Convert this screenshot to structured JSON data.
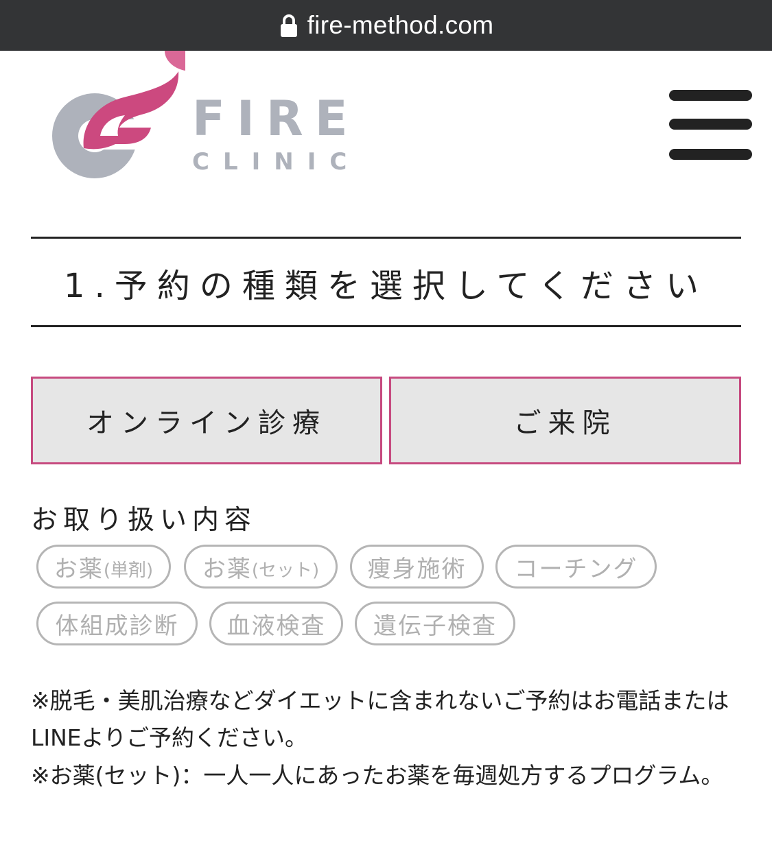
{
  "browser": {
    "url": "fire-method.com"
  },
  "logo": {
    "brand_main": "FIRE",
    "brand_sub": "CLINIC",
    "colors": {
      "pink": "#cc497f",
      "gray": "#aeb2bb"
    }
  },
  "header": {
    "menu_icon": "hamburger-menu-icon"
  },
  "section": {
    "title": "1.予約の種類を選択してください"
  },
  "reservation_types": [
    {
      "label": "オンライン診療"
    },
    {
      "label": "ご来院"
    }
  ],
  "handling": {
    "title": "お取り扱い内容",
    "tags": [
      {
        "main": "お薬",
        "sub": "(単剤)"
      },
      {
        "main": "お薬",
        "sub": "(セット)"
      },
      {
        "main": "痩身施術",
        "sub": ""
      },
      {
        "main": "コーチング",
        "sub": ""
      },
      {
        "main": "体組成診断",
        "sub": ""
      },
      {
        "main": "血液検査",
        "sub": ""
      },
      {
        "main": "遺伝子検査",
        "sub": ""
      }
    ]
  },
  "notes": {
    "note1": "※脱毛・美肌治療などダイエットに含まれないご予約はお電話またはLINEよりご予約ください。",
    "note2": "※お薬(セット)：一人一人にあったお薬を毎週処方するプログラム。"
  },
  "colors": {
    "accent": "#c64a7f",
    "button_bg": "#e6e6e6",
    "tag_border": "#b5b5b5",
    "urlbar_bg": "#333436"
  }
}
